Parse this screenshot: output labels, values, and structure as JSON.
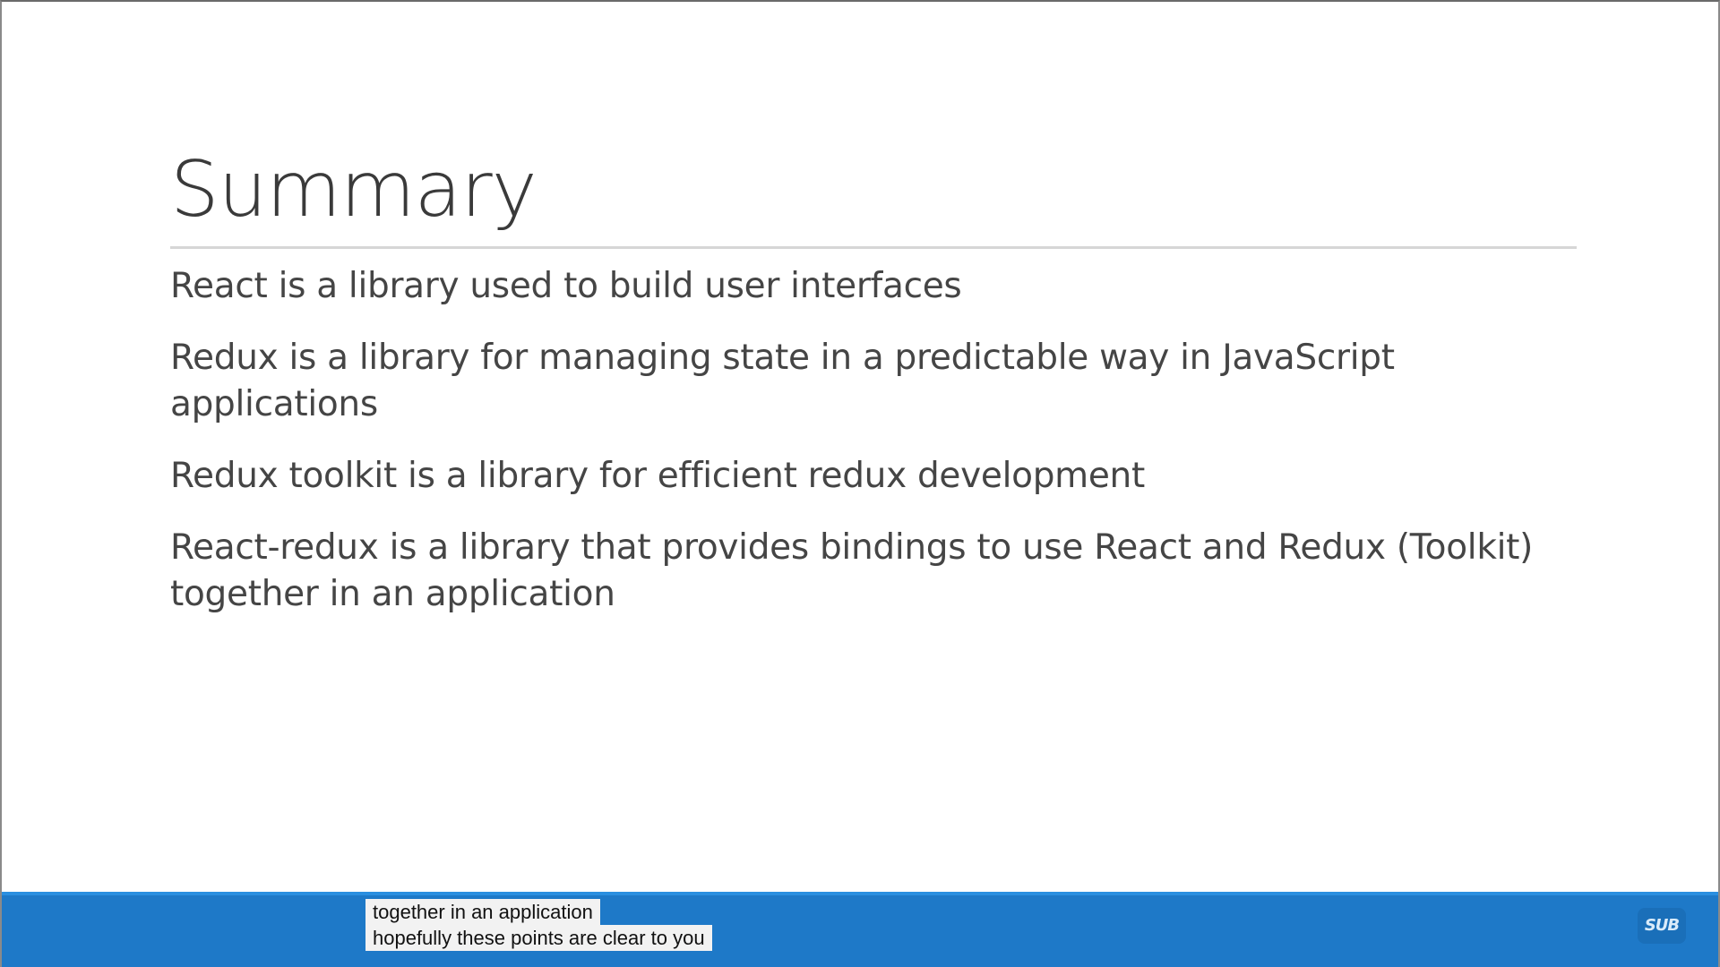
{
  "slide": {
    "title": "Summary",
    "bullets": [
      "React is a library used to build user interfaces",
      "Redux is a library for managing state in a predictable way in JavaScript applications",
      "Redux toolkit is a library for efficient redux development",
      "React-redux is a library that provides bindings to use React and Redux (Toolkit) together in an application"
    ]
  },
  "captions": {
    "lines": [
      "together in an application",
      "hopefully these points are clear to you"
    ],
    "badge": "SUB"
  },
  "colors": {
    "caption_bar": "#1e79c8",
    "caption_background": "#f2f2f2",
    "text": "#454545"
  }
}
